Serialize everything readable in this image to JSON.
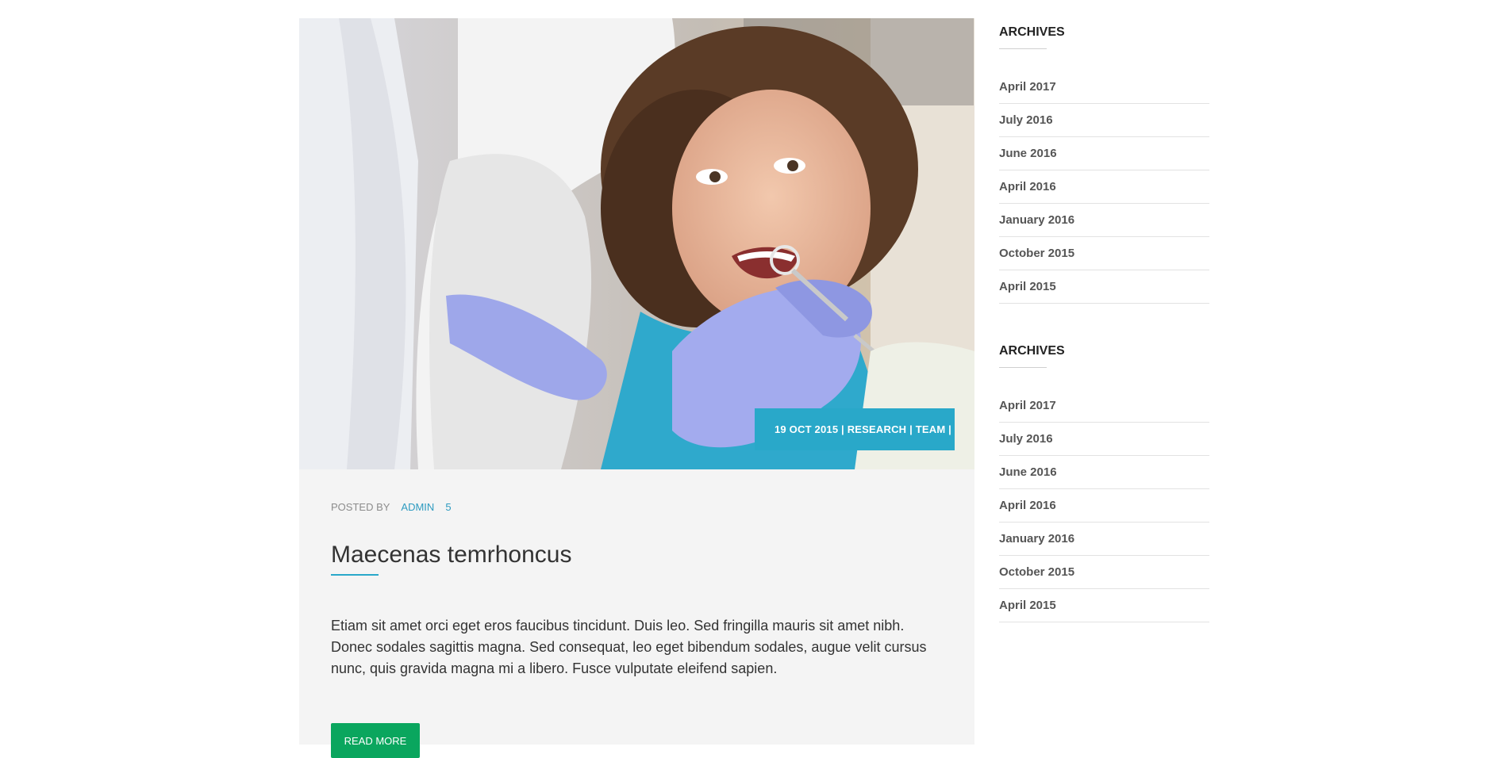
{
  "post": {
    "meta_badge": "19 OCT 2015 | RESEARCH | TEAM |",
    "posted_by_label": "POSTED BY",
    "author": "ADMIN",
    "comment_count": "5",
    "title": "Maecenas temrhoncus",
    "excerpt": "Etiam sit amet orci eget eros faucibus tincidunt. Duis leo. Sed fringilla mauris sit amet nibh. Donec sodales sagittis magna. Sed consequat, leo eget bibendum sodales, augue velit cursus nunc, quis gravida magna mi a libero. Fusce vulputate eleifend sapien.",
    "read_more": "READ MORE"
  },
  "sidebar": {
    "widgets": [
      {
        "title": "ARCHIVES",
        "items": [
          "April 2017",
          "July 2016",
          "June 2016",
          "April 2016",
          "January 2016",
          "October 2015",
          "April 2015"
        ]
      },
      {
        "title": "ARCHIVES",
        "items": [
          "April 2017",
          "July 2016",
          "June 2016",
          "April 2016",
          "January 2016",
          "October 2015",
          "April 2015"
        ]
      }
    ]
  },
  "colors": {
    "accent": "#29a8c9",
    "button": "#0aa65e",
    "card_bg": "#f4f4f4"
  }
}
